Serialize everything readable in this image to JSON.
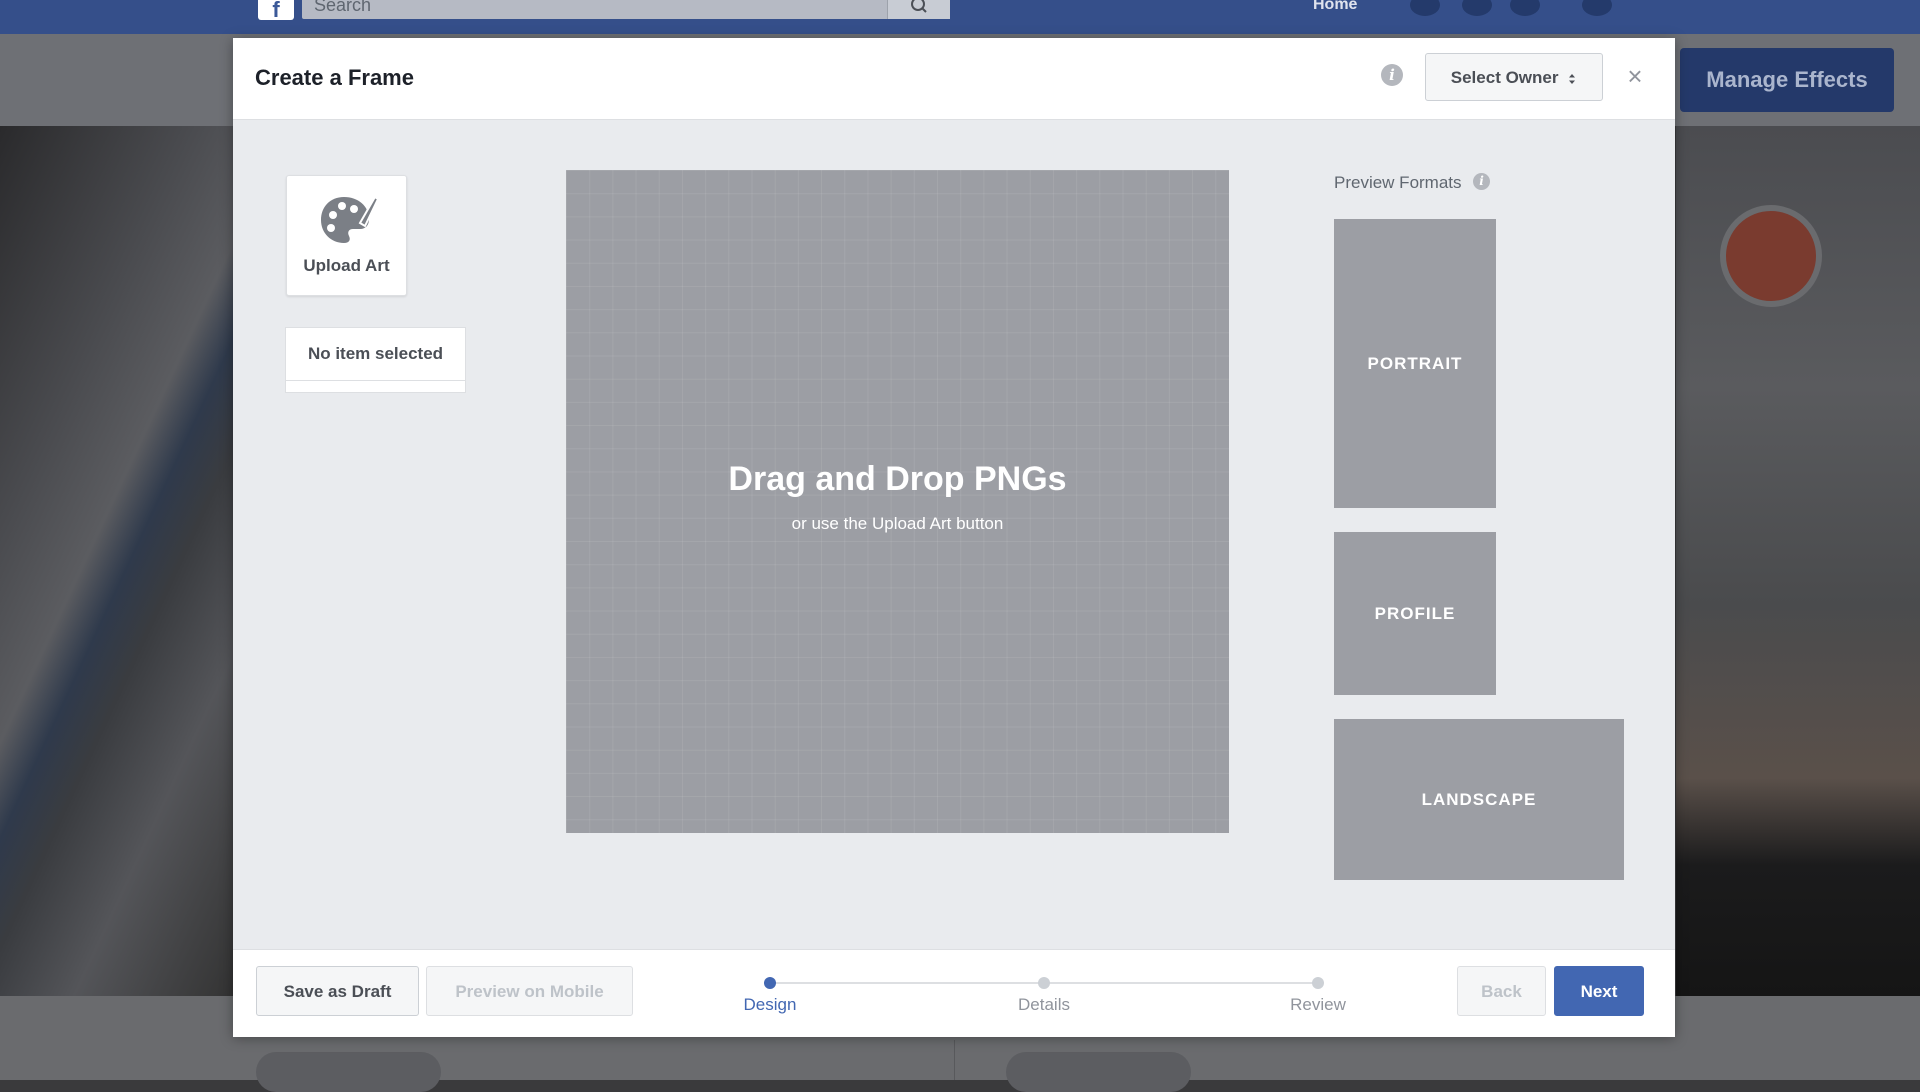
{
  "background": {
    "search_placeholder": "Search",
    "nav_home": "Home",
    "manage_effects_label": "Manage Effects"
  },
  "modal": {
    "title": "Create a Frame",
    "select_owner_label": "Select Owner",
    "close_symbol": "×",
    "upload_art_label": "Upload Art",
    "no_item_label": "No item selected",
    "canvas": {
      "title": "Drag and Drop PNGs",
      "subtitle": "or use the Upload Art button"
    },
    "preview": {
      "label": "Preview Formats",
      "formats": [
        "PORTRAIT",
        "PROFILE",
        "LANDSCAPE"
      ]
    },
    "footer": {
      "save_draft": "Save as Draft",
      "preview_mobile": "Preview on Mobile",
      "back": "Back",
      "next": "Next",
      "steps": [
        {
          "label": "Design",
          "active": true
        },
        {
          "label": "Details",
          "active": false
        },
        {
          "label": "Review",
          "active": false
        }
      ]
    }
  },
  "colors": {
    "primary": "#4267b2",
    "facebook_bar": "#354f8a",
    "preview_gray": "#9c9ea4"
  },
  "icons": [
    "facebook-logo-icon",
    "search-icon",
    "info-icon",
    "sort-arrows-icon",
    "close-icon",
    "palette-icon"
  ]
}
